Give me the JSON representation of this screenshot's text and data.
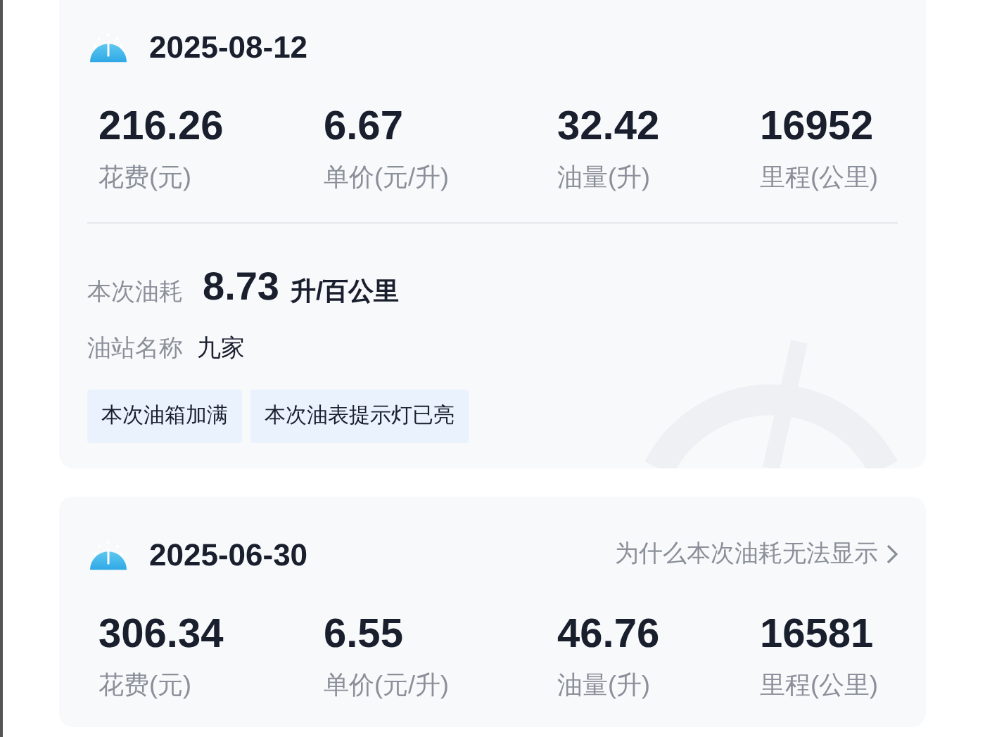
{
  "records": [
    {
      "date": "2025-08-12",
      "stats": [
        {
          "value": "216.26",
          "label": "花费(元)"
        },
        {
          "value": "6.67",
          "label": "单价(元/升)"
        },
        {
          "value": "32.42",
          "label": "油量(升)"
        },
        {
          "value": "16952",
          "label": "里程(公里)"
        }
      ],
      "consumption": {
        "label": "本次油耗",
        "value": "8.73",
        "unit": "升/百公里"
      },
      "station": {
        "label": "油站名称",
        "value": "九家"
      },
      "tags": [
        "本次油箱加满",
        "本次油表提示灯已亮"
      ]
    },
    {
      "date": "2025-06-30",
      "link": "为什么本次油耗无法显示",
      "stats": [
        {
          "value": "306.34",
          "label": "花费(元)"
        },
        {
          "value": "6.55",
          "label": "单价(元/升)"
        },
        {
          "value": "46.76",
          "label": "油量(升)"
        },
        {
          "value": "16581",
          "label": "里程(公里)"
        }
      ]
    }
  ]
}
